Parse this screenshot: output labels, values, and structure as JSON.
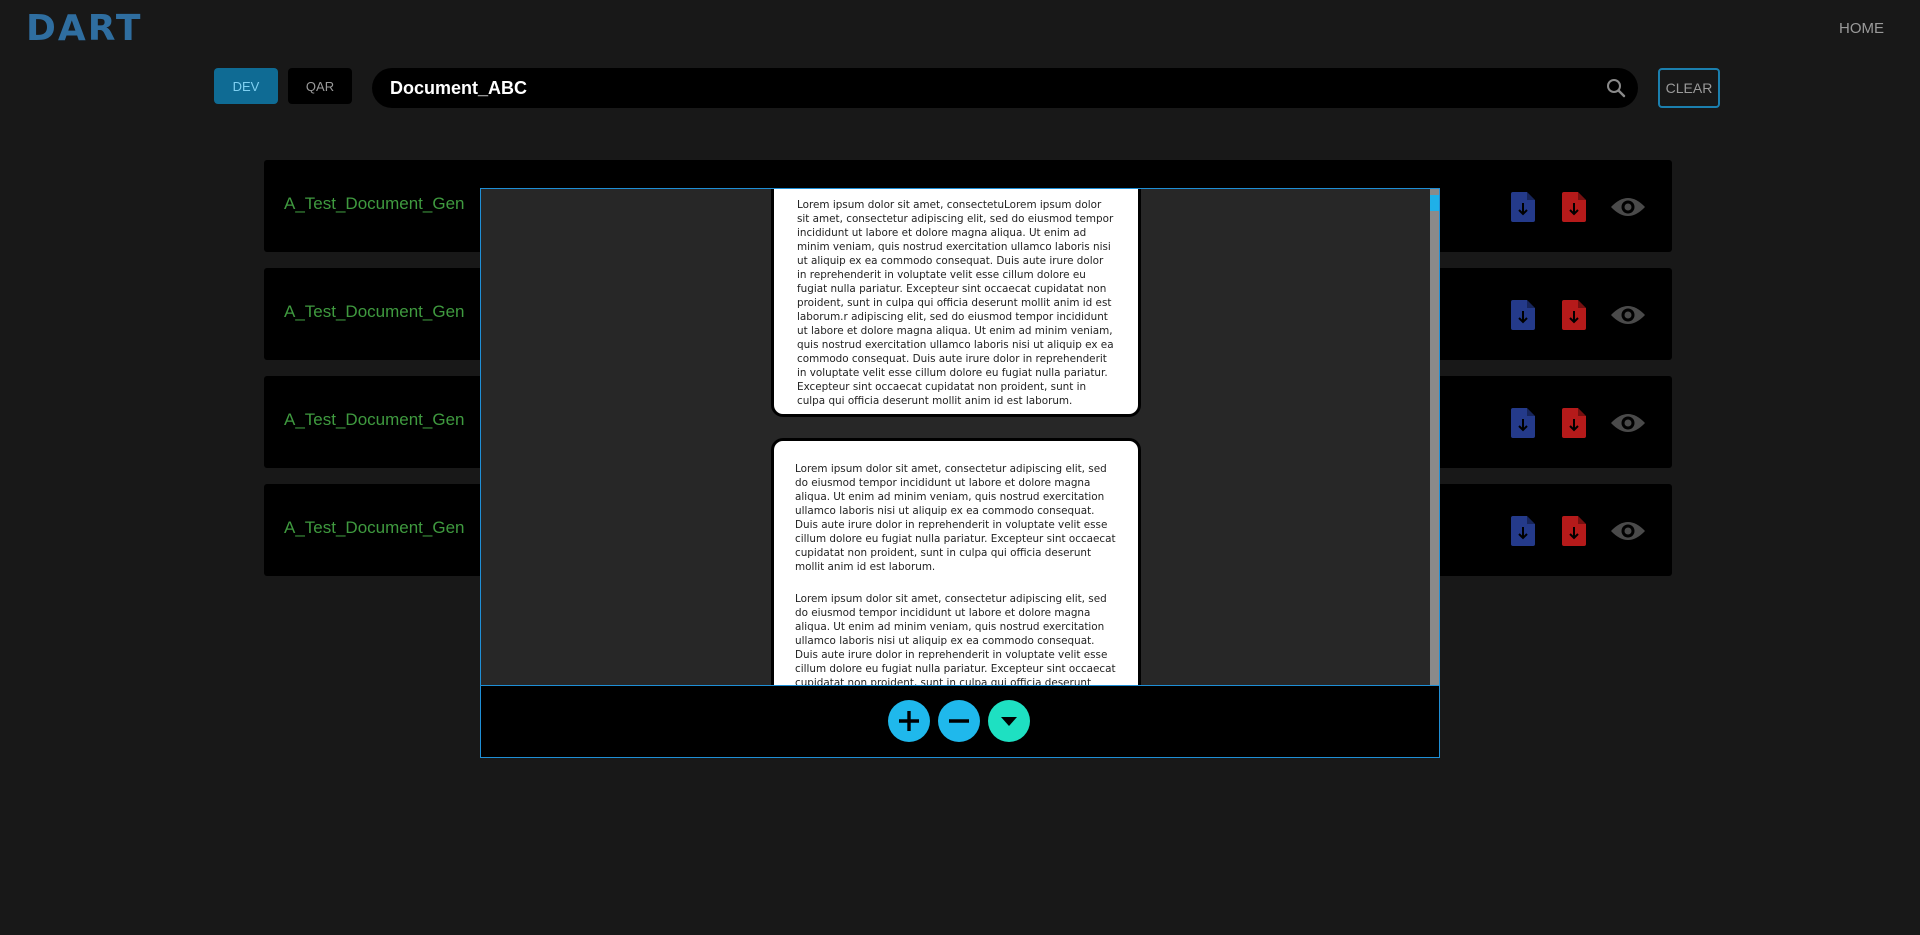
{
  "header": {
    "logo": "DART",
    "home_label": "HOME"
  },
  "env_tabs": [
    {
      "label": "DEV",
      "active": true
    },
    {
      "label": "QAR",
      "active": false
    }
  ],
  "search": {
    "value": "Document_ABC",
    "icon": "search-icon"
  },
  "clear_label": "CLEAR",
  "documents": [
    {
      "name": "A_Test_Document_Gen"
    },
    {
      "name": "A_Test_Document_Gen"
    },
    {
      "name": "A_Test_Document_Gen"
    },
    {
      "name": "A_Test_Document_Gen"
    }
  ],
  "viewer": {
    "page1_text": "Lorem ipsum dolor sit amet, consectetuLorem ipsum dolor sit amet, consectetur adipiscing elit, sed do eiusmod tempor incididunt ut labore et dolore magna aliqua. Ut enim ad minim veniam, quis nostrud exercitation ullamco laboris nisi ut aliquip ex ea commodo consequat. Duis aute irure dolor in reprehenderit in voluptate velit esse cillum dolore eu fugiat nulla pariatur. Excepteur sint occaecat cupidatat non proident, sunt in culpa qui officia deserunt mollit anim id est laborum.r adipiscing elit, sed do eiusmod tempor incididunt ut labore et dolore magna aliqua. Ut enim ad minim veniam, quis nostrud exercitation ullamco laboris nisi ut aliquip ex ea commodo consequat. Duis aute irure dolor in reprehenderit in voluptate velit esse cillum dolore eu fugiat nulla pariatur. Excepteur sint occaecat cupidatat non proident, sunt in culpa qui officia deserunt mollit anim id est laborum.",
    "page2_paragraphs": [
      "Lorem ipsum dolor sit amet, consectetur adipiscing elit, sed do eiusmod tempor incididunt ut labore et dolore magna aliqua. Ut enim ad minim veniam, quis nostrud exercitation ullamco laboris nisi ut aliquip ex ea commodo consequat. Duis aute irure dolor in reprehenderit in voluptate velit esse cillum dolore eu fugiat nulla pariatur. Excepteur sint occaecat cupidatat non proident, sunt in culpa qui officia deserunt mollit anim id est laborum.",
      "Lorem ipsum dolor sit amet, consectetur adipiscing elit, sed do eiusmod tempor incididunt ut labore et dolore magna aliqua. Ut enim ad minim veniam, quis nostrud exercitation ullamco laboris nisi ut aliquip ex ea commodo consequat. Duis aute irure dolor in reprehenderit in voluptate velit esse cillum dolore eu fugiat nulla pariatur. Excepteur sint occaecat cupidatat non proident, sunt in culpa qui officia deserunt mollit anim id est laborum."
    ],
    "controls": [
      {
        "icon": "plus-icon",
        "action": "zoom-in"
      },
      {
        "icon": "minus-icon",
        "action": "zoom-out"
      },
      {
        "icon": "chevron-down-icon",
        "action": "download"
      }
    ]
  },
  "colors": {
    "background": "#181818",
    "accent_blue": "#1fb8ec",
    "accent_teal": "#1ee0c2",
    "doc_name_green": "#3f9a3f",
    "download_blue": "#243a8a",
    "download_red": "#b51a1a"
  }
}
